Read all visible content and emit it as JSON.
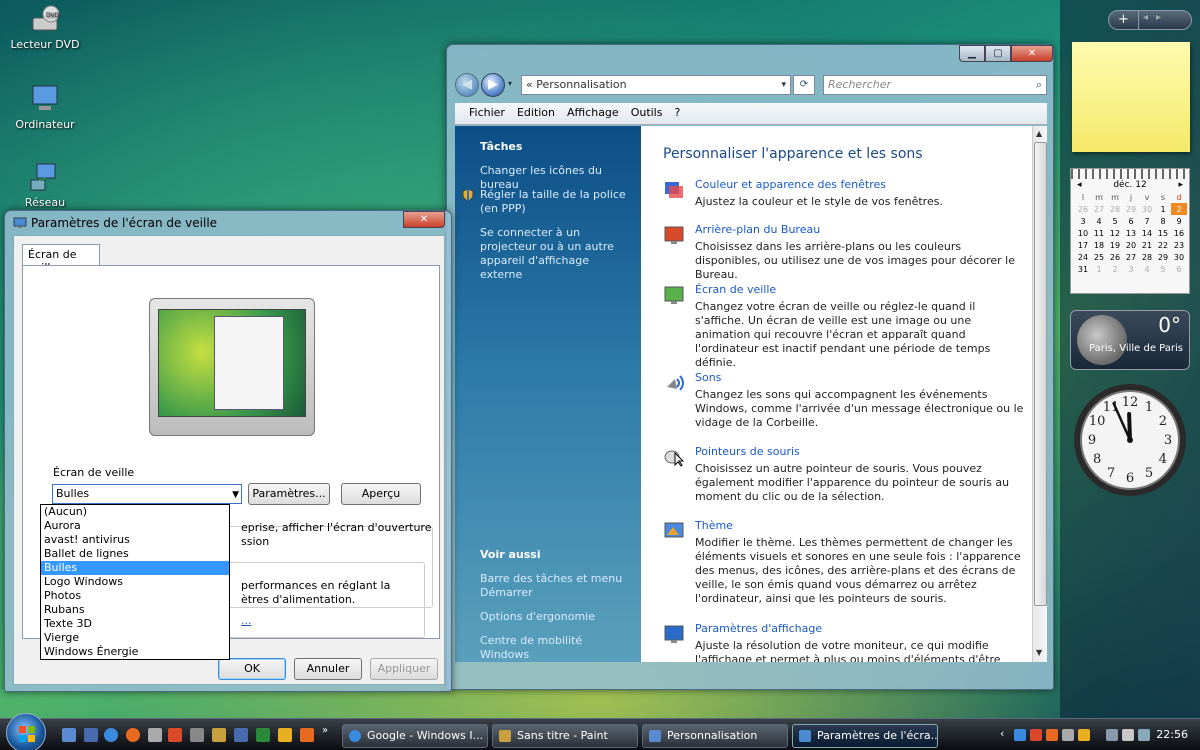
{
  "desktop": {
    "icons": [
      {
        "label": "Lecteur DVD"
      },
      {
        "label": "Ordinateur"
      },
      {
        "label": "Réseau"
      }
    ]
  },
  "sidebar": {
    "calendar": {
      "month": "déc. 12",
      "weekdays": [
        "l",
        "m",
        "m",
        "j",
        "v",
        "s",
        "d"
      ],
      "weeks": [
        [
          "26",
          "27",
          "28",
          "29",
          "30",
          "1",
          "2"
        ],
        [
          "3",
          "4",
          "5",
          "6",
          "7",
          "8",
          "9"
        ],
        [
          "10",
          "11",
          "12",
          "13",
          "14",
          "15",
          "16"
        ],
        [
          "17",
          "18",
          "19",
          "20",
          "21",
          "22",
          "23"
        ],
        [
          "24",
          "25",
          "26",
          "27",
          "28",
          "29",
          "30"
        ],
        [
          "31",
          "1",
          "2",
          "3",
          "4",
          "5",
          "6"
        ]
      ],
      "today": "2"
    },
    "weather": {
      "temp": "0°",
      "city": "Paris, Ville de Paris"
    },
    "clock": {
      "hour": 11,
      "minute": 56
    }
  },
  "personnalisation": {
    "address": "«  Personnalisation",
    "search_placeholder": "Rechercher",
    "menu": [
      "Fichier",
      "Edition",
      "Affichage",
      "Outils",
      "?"
    ],
    "tasks_title": "Tâches",
    "tasks": [
      "Changer les icônes du bureau",
      "Régler la taille de la police (en PPP)",
      "Se connecter à un projecteur ou à un autre appareil d'affichage externe"
    ],
    "see_also_title": "Voir aussi",
    "see_also": [
      "Barre des tâches et menu Démarrer",
      "Options d'ergonomie",
      "Centre de mobilité Windows"
    ],
    "content_title": "Personnaliser l'apparence et les sons",
    "items": [
      {
        "title": "Couleur et apparence des fenêtres",
        "desc": "Ajustez la couleur et le style de vos fenêtres."
      },
      {
        "title": "Arrière-plan du Bureau",
        "desc": "Choisissez dans les arrière-plans ou les couleurs disponibles, ou utilisez une de vos images pour décorer le Bureau."
      },
      {
        "title": "Écran de veille",
        "desc": "Changez votre écran de veille ou réglez-le quand il s'affiche. Un écran de veille est une image ou une animation qui recouvre l'écran et apparaît quand l'ordinateur est inactif pendant une période de temps définie."
      },
      {
        "title": "Sons",
        "desc": "Changez les sons qui accompagnent les événements Windows, comme l'arrivée d'un message électronique ou le vidage de la Corbeille."
      },
      {
        "title": "Pointeurs de souris",
        "desc": "Choisissez un autre pointeur de souris. Vous pouvez également modifier l'apparence du pointeur de souris au moment du clic ou de la sélection."
      },
      {
        "title": "Thème",
        "desc": "Modifier le thème. Les thèmes permettent de changer les éléments visuels et sonores en une seule fois : l'apparence des menus, des icônes, des arrière-plans et des écrans de veille, le son émis quand vous démarrez ou arrêtez l'ordinateur, ainsi que les pointeurs de souris."
      },
      {
        "title": "Paramètres d'affichage",
        "desc": "Ajuste la résolution de votre moniteur, ce qui modifie l'affichage et permet à plus ou moins d'éléments d'être visibles sur l'écran."
      }
    ]
  },
  "screensaver": {
    "title": "Paramètres de l'écran de veille",
    "tab": "Écran de veille",
    "group_label": "Écran de veille",
    "selected": "Bulles",
    "btn_params": "Paramètres...",
    "btn_preview": "Aperçu",
    "partial_text1a": "eprise, afficher l'écran d'ouverture",
    "partial_text1b": "ssion",
    "partial_text2a": "performances en réglant la",
    "partial_text2b": "ètres d'alimentation.",
    "partial_link": "...",
    "options": [
      "(Aucun)",
      "Aurora",
      "avast! antivirus",
      "Ballet de lignes",
      "Bulles",
      "Logo Windows",
      "Photos",
      "Rubans",
      "Texte 3D",
      "Vierge",
      "Windows Énergie"
    ],
    "ok": "OK",
    "cancel": "Annuler",
    "apply": "Appliquer"
  },
  "taskbar": {
    "buttons": [
      {
        "label": "Google - Windows I..."
      },
      {
        "label": "Sans titre - Paint"
      },
      {
        "label": "Personnalisation"
      },
      {
        "label": "Paramètres de l'écra..."
      }
    ],
    "time": "22:56"
  }
}
